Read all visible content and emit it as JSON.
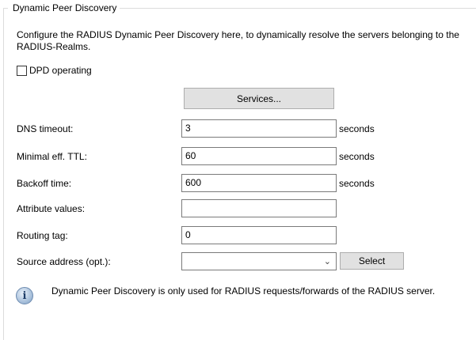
{
  "group": {
    "title": "Dynamic Peer Discovery"
  },
  "description": "Configure the RADIUS Dynamic Peer Discovery here, to dynamically resolve the servers belonging to the RADIUS-Realms.",
  "dpd": {
    "label": "DPD operating",
    "checked": false
  },
  "services_button": "Services...",
  "fields": {
    "dns_timeout": {
      "label": "DNS timeout:",
      "value": "3",
      "unit": "seconds"
    },
    "min_ttl": {
      "label": "Minimal eff. TTL:",
      "value": "60",
      "unit": "seconds"
    },
    "backoff": {
      "label": "Backoff time:",
      "value": "600",
      "unit": "seconds"
    },
    "attr_values": {
      "label": "Attribute values:",
      "value": ""
    },
    "routing_tag": {
      "label": "Routing tag:",
      "value": "0"
    },
    "source_address": {
      "label": "Source address (opt.):",
      "value": ""
    }
  },
  "select_button": "Select",
  "info": {
    "icon": "info-icon",
    "text": "Dynamic Peer Discovery is only used for RADIUS requests/forwards of the RADIUS server."
  }
}
